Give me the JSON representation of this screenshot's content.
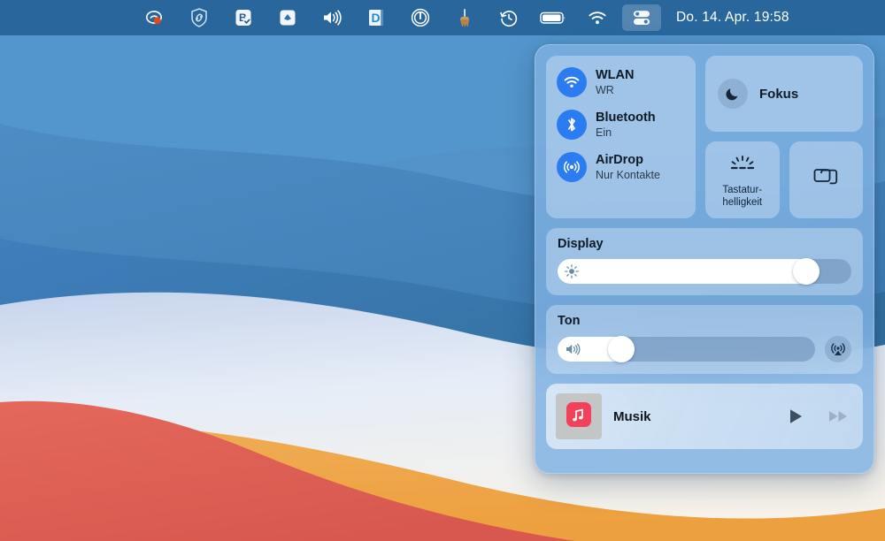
{
  "menubar": {
    "icons": [
      {
        "name": "cleanshot-icon",
        "label": "CleanShot"
      },
      {
        "name": "shield-link-icon",
        "label": "VPN Shield"
      },
      {
        "name": "bartender-icon",
        "label": "Bartender"
      },
      {
        "name": "dropbox-icon",
        "label": "Dropbox"
      },
      {
        "name": "volume-icon",
        "label": "Volume"
      },
      {
        "name": "dash-icon",
        "label": "Dash"
      },
      {
        "name": "power-icon",
        "label": "Power"
      },
      {
        "name": "broom-icon",
        "label": "CleanMyMac"
      },
      {
        "name": "time-machine-icon",
        "label": "Time Machine"
      },
      {
        "name": "battery-icon",
        "label": "Battery"
      },
      {
        "name": "wifi-icon",
        "label": "WLAN"
      },
      {
        "name": "control-center-icon",
        "label": "Kontrollzentrum"
      }
    ],
    "clock": "Do. 14. Apr.  19:58"
  },
  "control_center": {
    "connectivity": [
      {
        "icon": "wifi-icon",
        "title": "WLAN",
        "subtitle": "WR"
      },
      {
        "icon": "bluetooth-icon",
        "title": "Bluetooth",
        "subtitle": "Ein"
      },
      {
        "icon": "airdrop-icon",
        "title": "AirDrop",
        "subtitle": "Nur Kontakte"
      }
    ],
    "focus": {
      "label": "Fokus",
      "icon": "moon-icon"
    },
    "keyboard_brightness": {
      "label": "Tastatur-\nhelligkeit",
      "line1": "Tastatur-",
      "line2": "helligkeit",
      "icon": "keyboard-brightness-icon"
    },
    "screen_mirroring": {
      "label": "Bildschirmsynchronisierung",
      "icon": "screen-mirroring-icon"
    },
    "display": {
      "heading": "Display",
      "value_percent": 88,
      "icon": "brightness-icon"
    },
    "sound": {
      "heading": "Ton",
      "value_percent": 22,
      "icon": "speaker-icon",
      "airplay_icon": "airplay-audio-icon"
    },
    "music": {
      "title": "Musik",
      "app_icon": "music-app-icon",
      "play_label": "Abspielen",
      "forward_label": "Vorwärts"
    }
  },
  "colors": {
    "accent_blue": "#2b7cf0",
    "menubar_bg": "#1e5c91",
    "panel_bg": "#7eb0e2",
    "music_red": "#f2415a",
    "text_primary": "#101a26",
    "text_secondary": "#2b3b4d"
  }
}
